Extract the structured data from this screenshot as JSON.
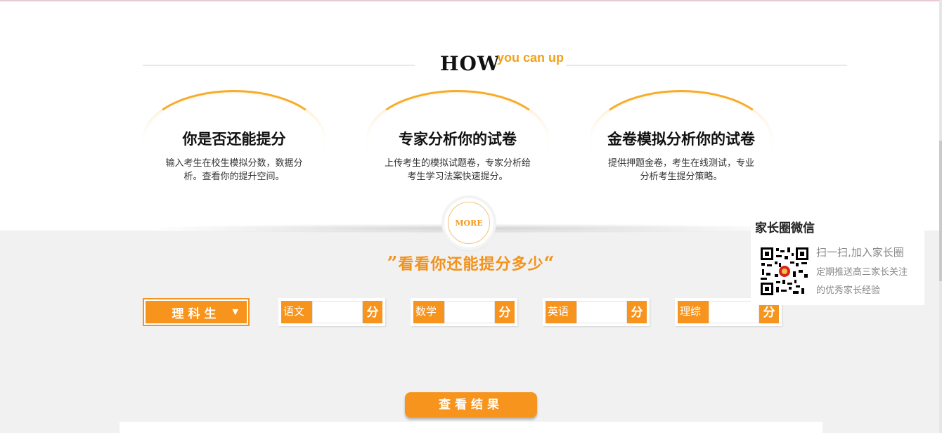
{
  "how": {
    "big": "HOW",
    "small": "you can up"
  },
  "cards": [
    {
      "title": "你是否还能提分",
      "desc": "输入考生在校生模拟分数，数据分析。查看你的提升空间。"
    },
    {
      "title": "专家分析你的试卷",
      "desc": "上传考生的模拟试题卷，专家分析给考生学习法案快速提分。"
    },
    {
      "title": "金卷模拟分析你的试卷",
      "desc": "提供押题金卷，考生在线测试，专业分析考生提分策略。"
    }
  ],
  "more_label": "MORE",
  "headline": {
    "open_quote": "”",
    "text": "看看你还能提分多少",
    "close_quote": "“"
  },
  "track": {
    "selected": "理科生",
    "arrow": "▼"
  },
  "subjects": [
    {
      "label": "语文",
      "value": "",
      "unit": "分"
    },
    {
      "label": "数学",
      "value": "",
      "unit": "分"
    },
    {
      "label": "英语",
      "value": "",
      "unit": "分"
    },
    {
      "label": "理综",
      "value": "",
      "unit": "分"
    }
  ],
  "result_button": "查看结果",
  "wechat": {
    "title": "家长圈微信",
    "line1": "扫一扫,加入家长圈",
    "line2": "定期推送高三家长关注",
    "line3": "的优秀家长经验",
    "qr_icon": "qr-code-icon"
  },
  "colors": {
    "accent": "#f7941d",
    "headline": "#f3921a",
    "gray_bg": "#f1f1f1"
  }
}
